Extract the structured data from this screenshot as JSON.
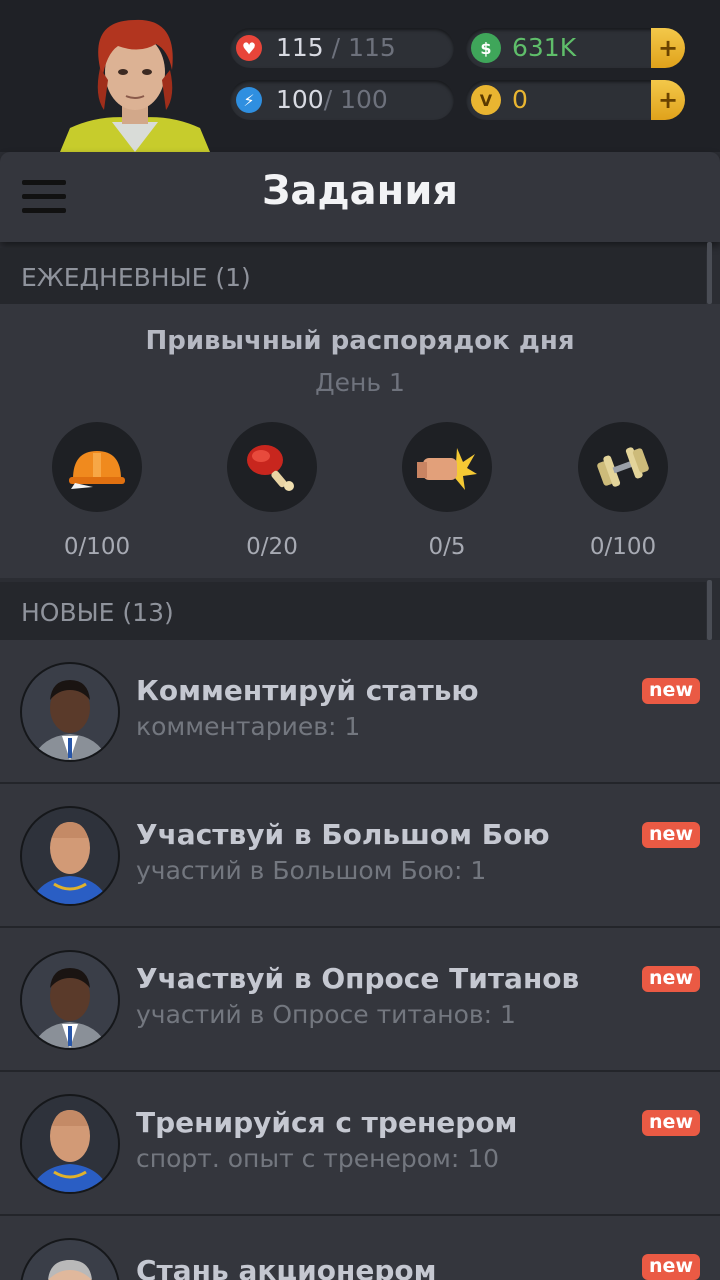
{
  "status": {
    "health": {
      "current": "115",
      "separator": "/",
      "max": "115"
    },
    "energy": {
      "current": "100",
      "separator": "/",
      "max": "100"
    },
    "money": {
      "value": "631K",
      "plus": "+"
    },
    "vip": {
      "value": "0",
      "plus": "+"
    }
  },
  "header": {
    "title": "Задания"
  },
  "daily": {
    "section_label": "ЕЖЕДНЕВНЫЕ (1)",
    "title": "Привычный распорядок дня",
    "subtitle": "День 1",
    "goals": [
      {
        "icon": "helmet-icon",
        "progress": "0/100"
      },
      {
        "icon": "meat-icon",
        "progress": "0/20"
      },
      {
        "icon": "fist-punch-icon",
        "progress": "0/5"
      },
      {
        "icon": "dumbbell-icon",
        "progress": "0/100"
      }
    ]
  },
  "new_tasks": {
    "section_label": "НОВЫЕ (13)",
    "items": [
      {
        "title": "Комментируй статью",
        "subtitle": "комментариев: 1",
        "badge": "new",
        "avatar": "man-suit"
      },
      {
        "title": "Участвуй в Большом Бою",
        "subtitle": "участий в Большом Бою: 1",
        "badge": "new",
        "avatar": "bald-man"
      },
      {
        "title": "Участвуй в Опросе Титанов",
        "subtitle": "участий в Опросе титанов: 1",
        "badge": "new",
        "avatar": "man-suit"
      },
      {
        "title": "Тренируйся с тренером",
        "subtitle": "спорт. опыт с тренером: 10",
        "badge": "new",
        "avatar": "bald-man"
      },
      {
        "title": "Стань акционером",
        "subtitle": "",
        "badge": "new",
        "avatar": "old-man"
      }
    ]
  },
  "colors": {
    "accent_green": "#5fbe6a",
    "badge_red": "#ea5a44",
    "gold": "#e9b531"
  }
}
